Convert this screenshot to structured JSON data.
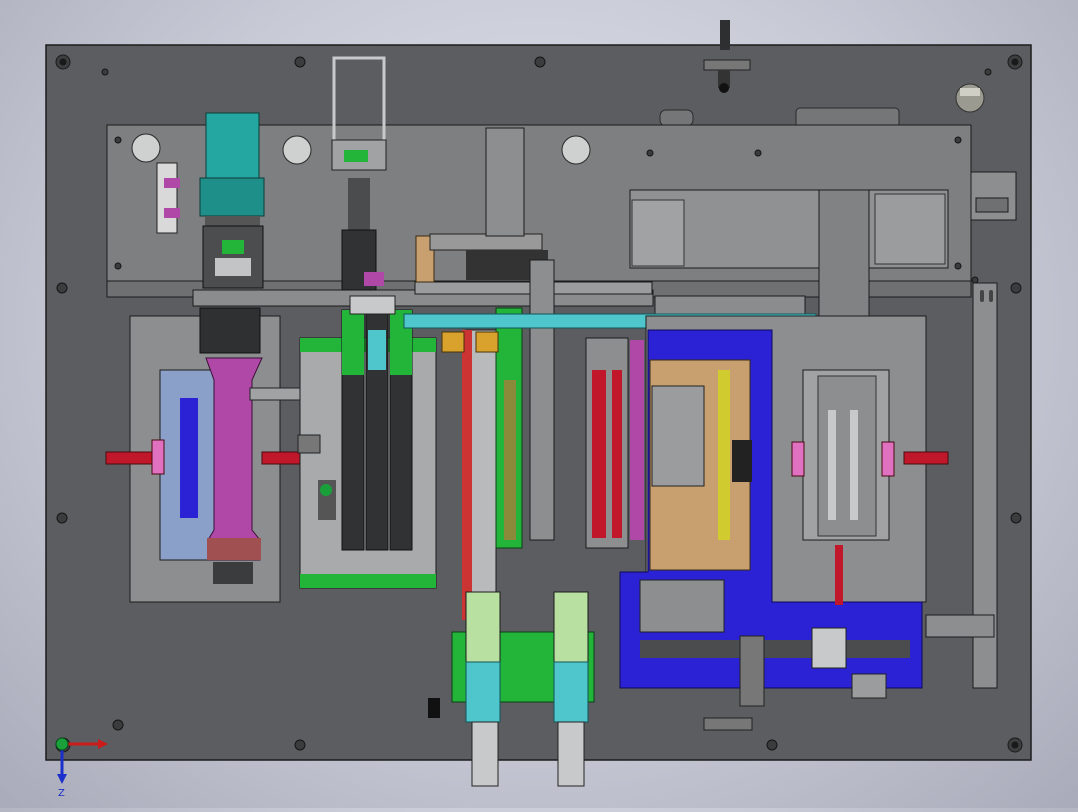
{
  "view": {
    "kind": "CAD assembly model, top view",
    "colors": {
      "viewport": "#c8cad6",
      "base_plate": "#5b5d60",
      "upper_plate": "#7d7f80",
      "sub_plate": "#8c8e90",
      "motor_teal": "#23a7a0",
      "magenta": "#b048a8",
      "green": "#22b53a",
      "blue_plate": "#2a22d4",
      "red_handle": "#c0182a",
      "yellow_fitting": "#d8a22c",
      "cyan": "#4ec6cc",
      "dark_cylinder": "#303234",
      "tan": "#c8a070"
    }
  },
  "triad": {
    "x_axis_color": "#cc1b1b",
    "y_axis_color": "#1aa03a",
    "z_axis_color": "#1b2fcc",
    "z_label": "Z"
  }
}
